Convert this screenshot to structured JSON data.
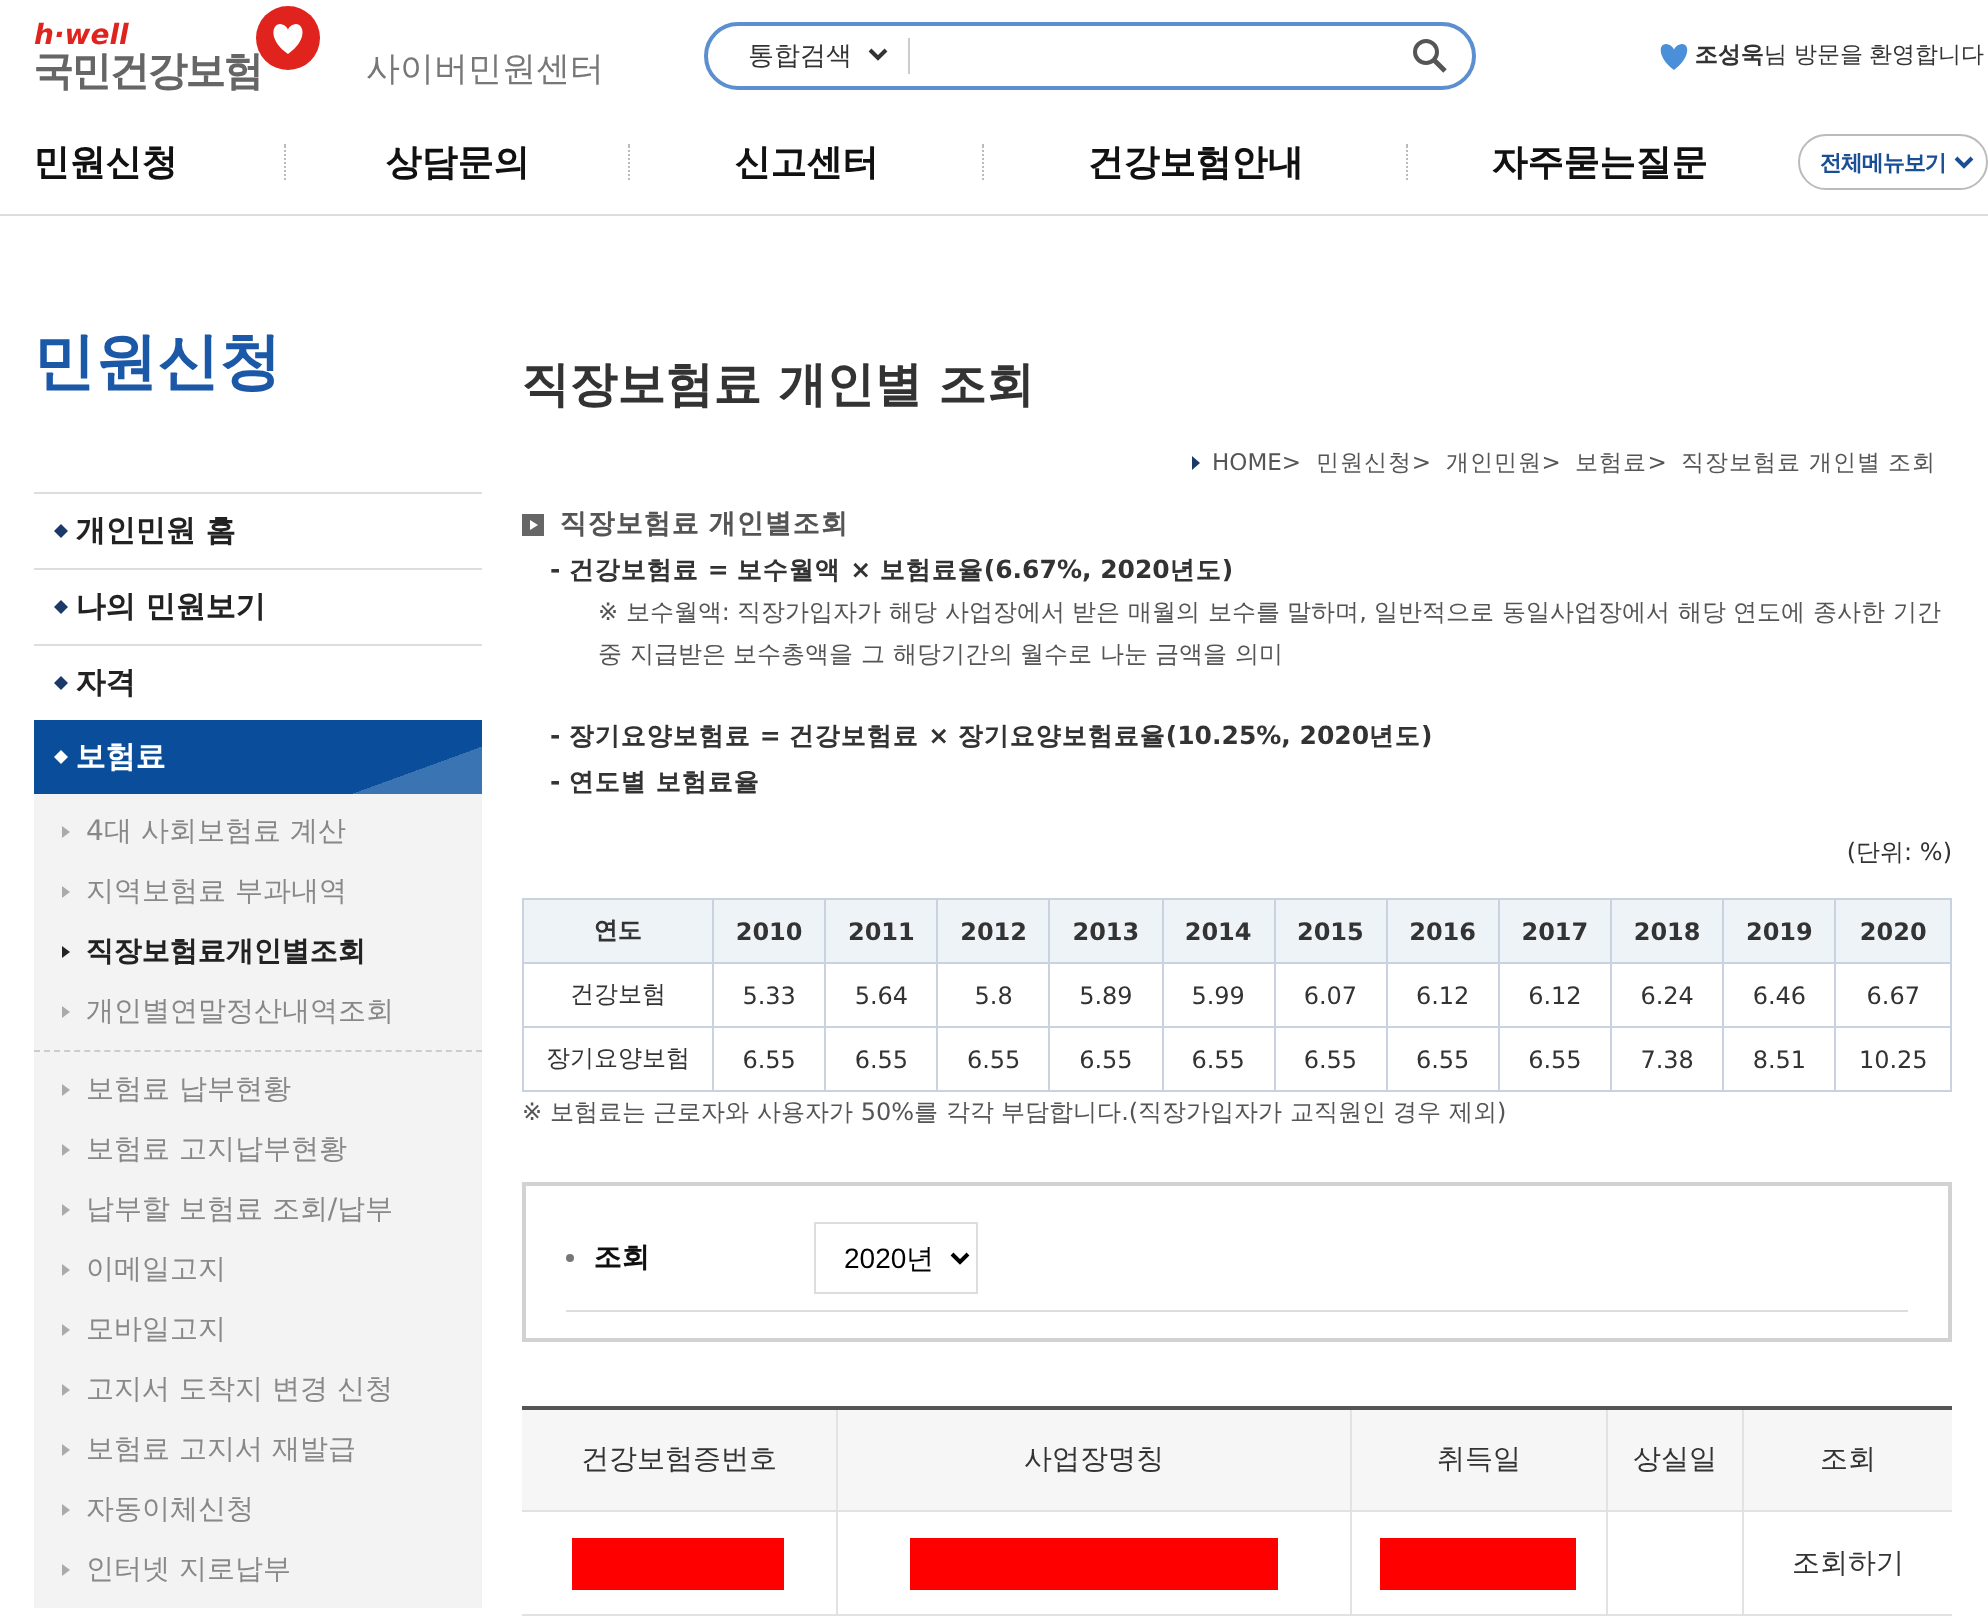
{
  "header": {
    "logo_tag": "h·well",
    "logo_text": "국민건강보험",
    "site_name": "사이버민원센터",
    "search": {
      "scope": "통합검색"
    },
    "user_name": "조성욱",
    "welcome": "님 방문을 환영합니다"
  },
  "nav": {
    "items": [
      "민원신청",
      "상담문의",
      "신고센터",
      "건강보험안내",
      "자주묻는질문"
    ],
    "all_menu": "전체메뉴보기"
  },
  "sidebar": {
    "title": "민원신청",
    "items": [
      {
        "label": "개인민원 홈",
        "selected": false
      },
      {
        "label": "나의 민원보기",
        "selected": false
      },
      {
        "label": "자격",
        "selected": false
      },
      {
        "label": "보험료",
        "selected": true,
        "sub_groups": [
          [
            {
              "label": "4대 사회보험료 계산",
              "selected": false
            },
            {
              "label": "지역보험료 부과내역",
              "selected": false
            },
            {
              "label": "직장보험료개인별조회",
              "selected": true
            },
            {
              "label": "개인별연말정산내역조회",
              "selected": false
            }
          ],
          [
            {
              "label": "보험료 납부현황",
              "selected": false
            },
            {
              "label": "보험료 고지납부현황",
              "selected": false
            },
            {
              "label": "납부할 보험료 조회/납부",
              "selected": false
            },
            {
              "label": "이메일고지",
              "selected": false
            },
            {
              "label": "모바일고지",
              "selected": false
            },
            {
              "label": "고지서 도착지 변경 신청",
              "selected": false
            },
            {
              "label": "보험료 고지서 재발급",
              "selected": false
            },
            {
              "label": "자동이체신청",
              "selected": false
            },
            {
              "label": "인터넷 지로납부",
              "selected": false
            }
          ]
        ]
      }
    ]
  },
  "content": {
    "title": "직장보험료 개인별 조회",
    "breadcrumb": "HOME>  민원신청>  개인민원>  보험료>  직장보험료 개인별 조회",
    "section_title": "직장보험료 개인별조회",
    "formulas": [
      {
        "text": "- 건강보험료 = 보수월액 × 보험료율(6.67%, 2020년도)",
        "note": "※ 보수월액: 직장가입자가 해당 사업장에서 받은 매월의 보수를 말하며, 일반적으로 동일사업장에서 해당 연도에 종사한 기간 중 지급받은 보수총액을 그 해당기간의 월수로 나눈 금액을 의미"
      },
      {
        "text": "- 장기요양보험료 = 건강보험료 × 장기요양보험료율(10.25%, 2020년도)"
      },
      {
        "text": "- 연도별 보험료율"
      }
    ],
    "unit": "(단위: %)",
    "rate_table": {
      "columns": [
        "연도",
        "2010",
        "2011",
        "2012",
        "2013",
        "2014",
        "2015",
        "2016",
        "2017",
        "2018",
        "2019",
        "2020"
      ],
      "rows": [
        [
          "건강보험",
          "5.33",
          "5.64",
          "5.8",
          "5.89",
          "5.99",
          "6.07",
          "6.12",
          "6.12",
          "6.24",
          "6.46",
          "6.67"
        ],
        [
          "장기요양보험",
          "6.55",
          "6.55",
          "6.55",
          "6.55",
          "6.55",
          "6.55",
          "6.55",
          "6.55",
          "7.38",
          "8.51",
          "10.25"
        ]
      ]
    },
    "table_note": "※ 보험료는 근로자와 사용자가 50%를 각각 부담합니다.(직장가입자가 교직원인 경우 제외)",
    "query": {
      "label": "조회",
      "year": "2020년"
    },
    "result_table": {
      "columns": [
        "건강보험증번호",
        "사업장명칭",
        "취득일",
        "상실일",
        "조회"
      ],
      "rows": [
        [
          {
            "kind": "redacted"
          },
          {
            "kind": "redacted"
          },
          {
            "kind": "redacted"
          },
          {
            "kind": "empty"
          },
          {
            "kind": "link",
            "text": "조회하기"
          }
        ]
      ]
    }
  }
}
